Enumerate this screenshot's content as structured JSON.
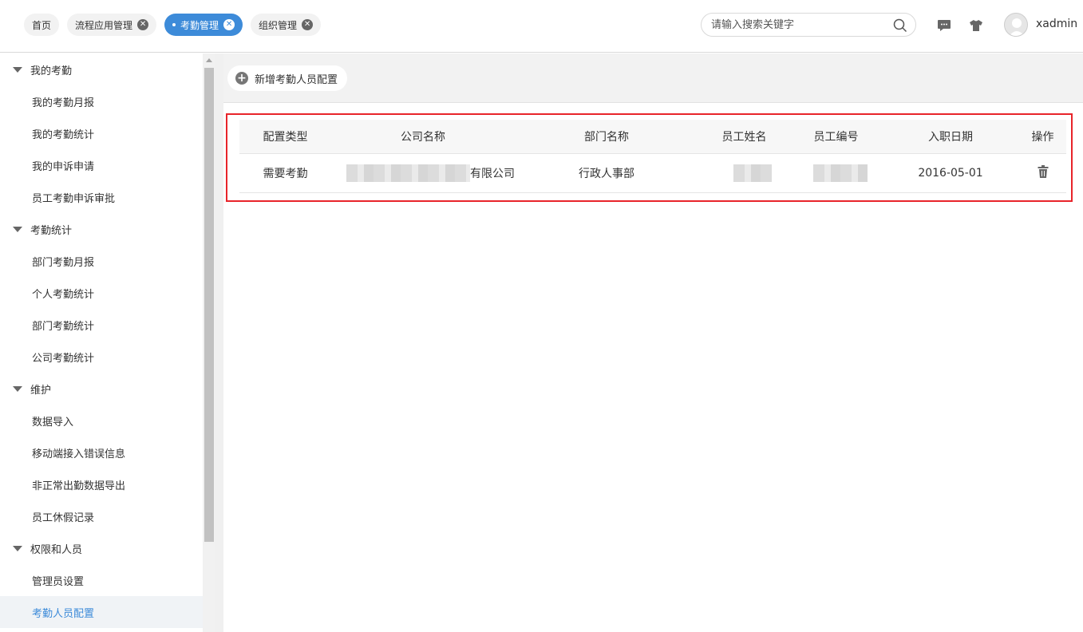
{
  "tabs": [
    {
      "label": "首页",
      "closable": false,
      "active": false
    },
    {
      "label": "流程应用管理",
      "closable": true,
      "active": false
    },
    {
      "label": "考勤管理",
      "closable": true,
      "active": true
    },
    {
      "label": "组织管理",
      "closable": true,
      "active": false
    }
  ],
  "search": {
    "placeholder": "请输入搜索关键字",
    "value": ""
  },
  "header": {
    "username": "xadmin",
    "icons": [
      "message-icon",
      "skin-icon",
      "avatar"
    ]
  },
  "sidebar": {
    "groups": [
      {
        "label": "我的考勤",
        "items": [
          "我的考勤月报",
          "我的考勤统计",
          "我的申诉申请",
          "员工考勤申诉审批"
        ]
      },
      {
        "label": "考勤统计",
        "items": [
          "部门考勤月报",
          "个人考勤统计",
          "部门考勤统计",
          "公司考勤统计"
        ]
      },
      {
        "label": "维护",
        "items": [
          "数据导入",
          "移动端接入错误信息",
          "非正常出勤数据导出",
          "员工休假记录"
        ]
      },
      {
        "label": "权限和人员",
        "items": [
          "管理员设置",
          "考勤人员配置"
        ]
      }
    ],
    "active_item": "考勤人员配置"
  },
  "toolbar": {
    "add_label": "新增考勤人员配置"
  },
  "table": {
    "columns": [
      "配置类型",
      "公司名称",
      "部门名称",
      "员工姓名",
      "员工编号",
      "入职日期",
      "操作"
    ],
    "rows": [
      {
        "type": "需要考勤",
        "company_suffix": "有限公司",
        "department": "行政人事部",
        "hire_date": "2016-05-01"
      }
    ]
  },
  "colors": {
    "accent": "#3d8bd9",
    "highlight_border": "#e8242a"
  }
}
